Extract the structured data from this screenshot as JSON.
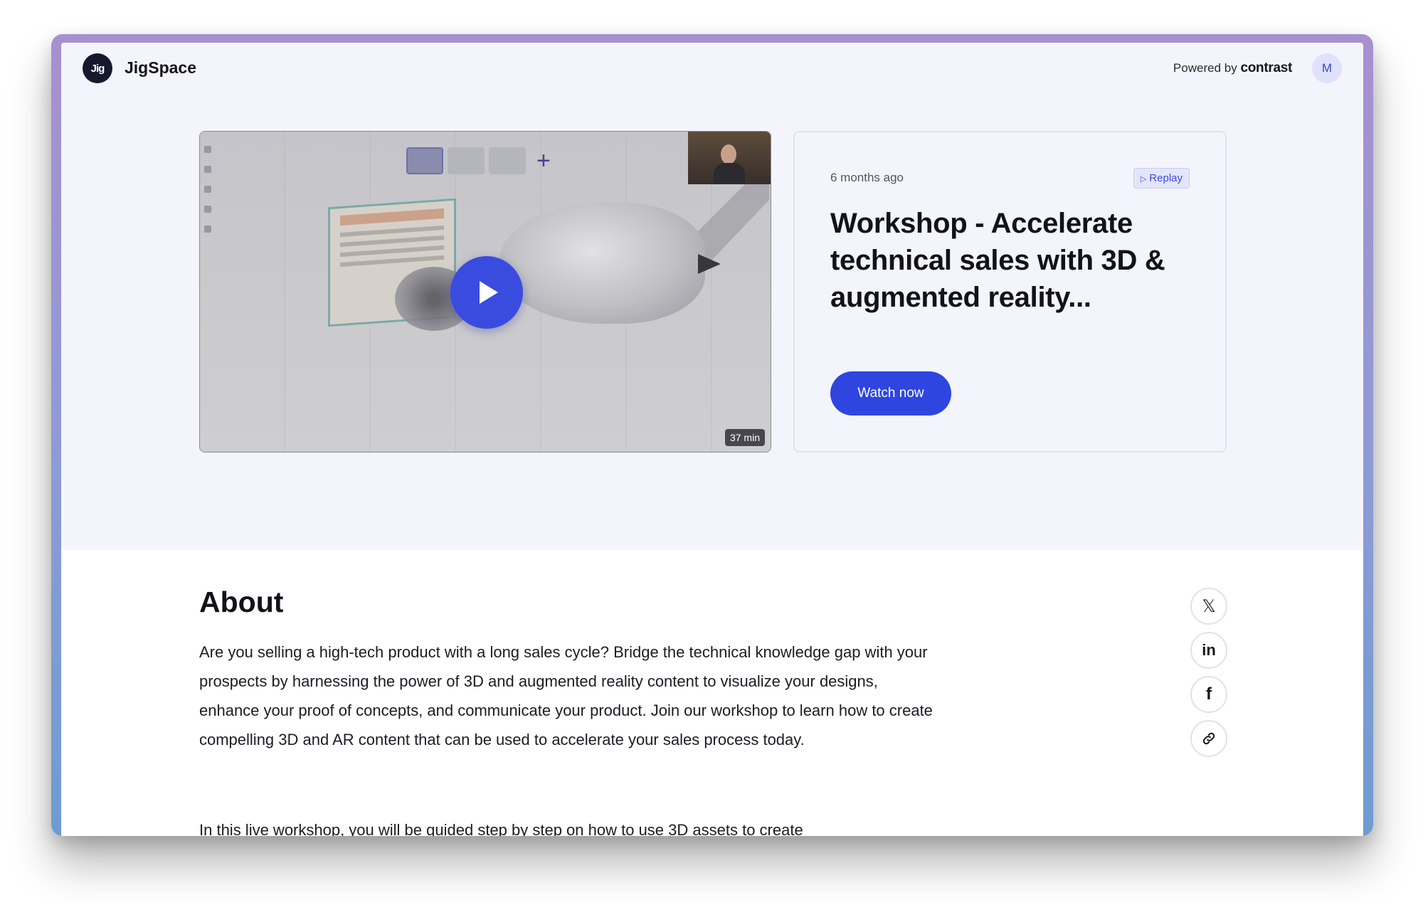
{
  "header": {
    "logo_text": "Jig",
    "brand": "JigSpace",
    "powered_prefix": "Powered by",
    "powered_brand": "contrast",
    "avatar_initial": "M"
  },
  "hero": {
    "duration": "37 min",
    "posted": "6 months ago",
    "replay_label": "Replay",
    "title": "Workshop - Accelerate technical sales with 3D & augmented reality...",
    "watch_label": "Watch now"
  },
  "about": {
    "heading": "About",
    "paragraph1": "Are you selling a high-tech product with a long sales cycle? Bridge the technical knowledge gap with your prospects by harnessing the power of 3D and augmented reality content to visualize your designs, enhance your proof of concepts, and communicate your product. Join our workshop to learn how to create compelling 3D and AR content that can be used to accelerate your sales process today.",
    "paragraph2": "In this live workshop, you will be guided step by step on how to use 3D assets to create"
  },
  "share": {
    "x_glyph": "𝕏",
    "linkedin_glyph": "in",
    "facebook_glyph": "f"
  },
  "colors": {
    "accent": "#2f45e0",
    "page_bg": "#f4f5fc",
    "text": "#12121a"
  }
}
